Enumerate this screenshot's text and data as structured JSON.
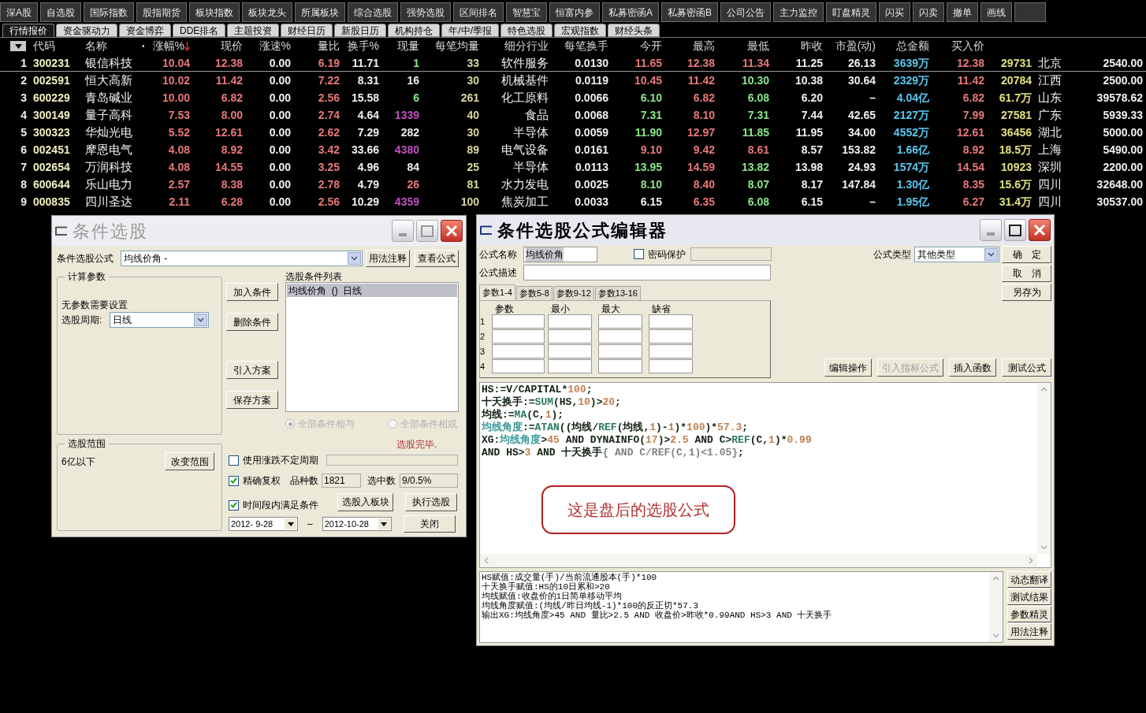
{
  "toolbar": [
    {
      "kind": "normal",
      "label": "深A股"
    },
    {
      "kind": "normal",
      "label": "自选股"
    },
    {
      "kind": "normal",
      "label": "国际指数"
    },
    {
      "kind": "normal",
      "label": "股指期货"
    },
    {
      "kind": "normal",
      "label": "板块指数"
    },
    {
      "kind": "normal",
      "label": "板块龙头"
    },
    {
      "kind": "normal",
      "label": "所属板块"
    },
    {
      "kind": "normal",
      "label": "综合选股"
    },
    {
      "kind": "normal",
      "label": "强势选股"
    },
    {
      "kind": "normal",
      "label": "区间排名"
    },
    {
      "kind": "normal",
      "label": "智慧宝"
    },
    {
      "kind": "normal",
      "label": "恒富内参"
    },
    {
      "kind": "normal",
      "label": "私募密函A"
    },
    {
      "kind": "normal",
      "label": "私募密函B"
    },
    {
      "kind": "normal",
      "label": "公司公告"
    },
    {
      "kind": "normal",
      "label": "主力监控"
    },
    {
      "kind": "normal",
      "label": "盯盘精灵"
    },
    {
      "kind": "normal",
      "label": "闪买"
    },
    {
      "kind": "normal",
      "label": "闪卖"
    },
    {
      "kind": "normal",
      "label": "撤单"
    },
    {
      "kind": "normal",
      "label": "画线"
    },
    {
      "kind": "alert"
    }
  ],
  "tabs": [
    {
      "label": "行情报价",
      "selected": true
    },
    {
      "label": "资金驱动力",
      "selected": false
    },
    {
      "label": "资金博弈",
      "selected": false
    },
    {
      "label": "DDE排名",
      "selected": false
    },
    {
      "label": "主题投资",
      "selected": false
    },
    {
      "label": "财经日历",
      "selected": false
    },
    {
      "label": "新股日历",
      "selected": false
    },
    {
      "label": "机构持仓",
      "selected": false
    },
    {
      "label": "年/中/季报",
      "selected": false
    },
    {
      "label": "特色选股",
      "selected": false
    },
    {
      "label": "宏观指数",
      "selected": false
    },
    {
      "label": "财经头条",
      "selected": false
    }
  ],
  "table": {
    "columns": [
      {
        "kind": "menu",
        "sorted": false
      },
      {
        "kind": "text",
        "label": "代码",
        "sorted": false
      },
      {
        "kind": "text",
        "label": "名称",
        "sorted": false
      },
      {
        "kind": "text",
        "prefix": "•",
        "label": "涨幅%",
        "sorted": true
      },
      {
        "label": "现价",
        "sorted": false
      },
      {
        "label": "涨速%",
        "sorted": false
      },
      {
        "label": "量比",
        "sorted": false
      },
      {
        "label": "换手%",
        "sorted": false
      },
      {
        "label": "现量",
        "sorted": false
      },
      {
        "label": "每笔均量",
        "sorted": false
      },
      {
        "label": "细分行业",
        "sorted": false
      },
      {
        "label": "每笔换手",
        "sorted": false
      },
      {
        "label": "今开",
        "sorted": false
      },
      {
        "label": "最高",
        "sorted": false
      },
      {
        "label": "最低",
        "sorted": false
      },
      {
        "label": "昨收",
        "sorted": false
      },
      {
        "label": "市盈(动)",
        "sorted": false
      },
      {
        "label": "总金额",
        "sorted": false
      },
      {
        "label": "买入价",
        "sorted": false
      }
    ],
    "rows": [
      {
        "selected": true,
        "cells": [
          {
            "text": "1"
          },
          {
            "text": "300231",
            "color": "#f0f0c0"
          },
          {
            "text": "银信科技"
          },
          {
            "text": "10.04",
            "color": "#e87878"
          },
          {
            "text": "12.38",
            "color": "#e87878"
          },
          {
            "text": "0.00"
          },
          {
            "text": "6.19",
            "color": "#e87878"
          },
          {
            "text": "11.71"
          },
          {
            "text": "1",
            "color": "#88e888"
          },
          {
            "text": "33",
            "color": "#d8d8a0"
          },
          {
            "text": "软件服务"
          },
          {
            "text": "0.0130"
          },
          {
            "text": "11.65",
            "color": "#e87878"
          },
          {
            "text": "12.38",
            "color": "#e87878"
          },
          {
            "text": "11.34",
            "color": "#e87878"
          },
          {
            "text": "11.25"
          },
          {
            "text": "26.13"
          },
          {
            "text": "3639万",
            "color": "#58c8f0"
          },
          {
            "text": "12.38",
            "color": "#e87878"
          },
          {
            "text": "29731",
            "color": "#e0e080"
          },
          {
            "text": "北京"
          },
          {
            "text": "2540.00"
          }
        ]
      },
      {
        "selected": false,
        "cells": [
          {
            "text": "2"
          },
          {
            "text": "002591",
            "color": "#f0f0c0"
          },
          {
            "text": "恒大高新"
          },
          {
            "text": "10.02",
            "color": "#e87878"
          },
          {
            "text": "11.42",
            "color": "#e87878"
          },
          {
            "text": "0.00"
          },
          {
            "text": "7.22",
            "color": "#e87878"
          },
          {
            "text": "8.31"
          },
          {
            "text": "16"
          },
          {
            "text": "30",
            "color": "#d8d8a0"
          },
          {
            "text": "机械基件"
          },
          {
            "text": "0.0119"
          },
          {
            "text": "10.45",
            "color": "#e87878"
          },
          {
            "text": "11.42",
            "color": "#e87878"
          },
          {
            "text": "10.30",
            "color": "#88e888"
          },
          {
            "text": "10.38"
          },
          {
            "text": "30.64"
          },
          {
            "text": "2329万",
            "color": "#58c8f0"
          },
          {
            "text": "11.42",
            "color": "#e87878"
          },
          {
            "text": "20784",
            "color": "#e0e080"
          },
          {
            "text": "江西"
          },
          {
            "text": "2500.00"
          }
        ]
      },
      {
        "selected": false,
        "cells": [
          {
            "text": "3"
          },
          {
            "text": "600229",
            "color": "#f0f0c0"
          },
          {
            "text": "青岛碱业"
          },
          {
            "text": "10.00",
            "color": "#e87878"
          },
          {
            "text": "6.82",
            "color": "#e87878"
          },
          {
            "text": "0.00"
          },
          {
            "text": "2.56",
            "color": "#e87878"
          },
          {
            "text": "15.58"
          },
          {
            "text": "6",
            "color": "#88e888"
          },
          {
            "text": "261",
            "color": "#d8d8a0"
          },
          {
            "text": "化工原料"
          },
          {
            "text": "0.0066"
          },
          {
            "text": "6.10",
            "color": "#88e888"
          },
          {
            "text": "6.82",
            "color": "#e87878"
          },
          {
            "text": "6.08",
            "color": "#88e888"
          },
          {
            "text": "6.20"
          },
          {
            "text": "–"
          },
          {
            "text": "4.04亿",
            "color": "#58c8f0"
          },
          {
            "text": "6.82",
            "color": "#e87878"
          },
          {
            "text": "61.7万",
            "color": "#e0e080"
          },
          {
            "text": "山东"
          },
          {
            "text": "39578.62"
          }
        ]
      },
      {
        "selected": false,
        "cells": [
          {
            "text": "4"
          },
          {
            "text": "300149",
            "color": "#f0f0c0"
          },
          {
            "text": "量子高科"
          },
          {
            "text": "7.53",
            "color": "#e87878"
          },
          {
            "text": "8.00",
            "color": "#e87878"
          },
          {
            "text": "0.00"
          },
          {
            "text": "2.74",
            "color": "#e87878"
          },
          {
            "text": "4.64"
          },
          {
            "text": "1339",
            "color": "#c050c0"
          },
          {
            "text": "40",
            "color": "#d8d8a0"
          },
          {
            "text": "食品"
          },
          {
            "text": "0.0068"
          },
          {
            "text": "7.31",
            "color": "#88e888"
          },
          {
            "text": "8.10",
            "color": "#e87878"
          },
          {
            "text": "7.31",
            "color": "#88e888"
          },
          {
            "text": "7.44"
          },
          {
            "text": "42.65"
          },
          {
            "text": "2127万",
            "color": "#58c8f0"
          },
          {
            "text": "7.99",
            "color": "#e87878"
          },
          {
            "text": "27581",
            "color": "#e0e080"
          },
          {
            "text": "广东"
          },
          {
            "text": "5939.33"
          }
        ]
      },
      {
        "selected": false,
        "cells": [
          {
            "text": "5"
          },
          {
            "text": "300323",
            "color": "#f0f0c0"
          },
          {
            "text": "华灿光电"
          },
          {
            "text": "5.52",
            "color": "#e87878"
          },
          {
            "text": "12.61",
            "color": "#e87878"
          },
          {
            "text": "0.00"
          },
          {
            "text": "2.62",
            "color": "#e87878"
          },
          {
            "text": "7.29"
          },
          {
            "text": "282"
          },
          {
            "text": "30",
            "color": "#d8d8a0"
          },
          {
            "text": "半导体"
          },
          {
            "text": "0.0059"
          },
          {
            "text": "11.90",
            "color": "#88e888"
          },
          {
            "text": "12.97",
            "color": "#e87878"
          },
          {
            "text": "11.85",
            "color": "#88e888"
          },
          {
            "text": "11.95"
          },
          {
            "text": "34.00"
          },
          {
            "text": "4552万",
            "color": "#58c8f0"
          },
          {
            "text": "12.61",
            "color": "#e87878"
          },
          {
            "text": "36456",
            "color": "#e0e080"
          },
          {
            "text": "湖北"
          },
          {
            "text": "5000.00"
          }
        ]
      },
      {
        "selected": false,
        "cells": [
          {
            "text": "6"
          },
          {
            "text": "002451",
            "color": "#f0f0c0"
          },
          {
            "text": "摩恩电气"
          },
          {
            "text": "4.08",
            "color": "#e87878"
          },
          {
            "text": "8.92",
            "color": "#e87878"
          },
          {
            "text": "0.00"
          },
          {
            "text": "3.42",
            "color": "#e87878"
          },
          {
            "text": "33.66"
          },
          {
            "text": "4380",
            "color": "#c050c0"
          },
          {
            "text": "89",
            "color": "#d8d8a0"
          },
          {
            "text": "电气设备"
          },
          {
            "text": "0.0161"
          },
          {
            "text": "9.10",
            "color": "#e87878"
          },
          {
            "text": "9.42",
            "color": "#e87878"
          },
          {
            "text": "8.61",
            "color": "#e87878"
          },
          {
            "text": "8.57"
          },
          {
            "text": "153.82"
          },
          {
            "text": "1.66亿",
            "color": "#58c8f0"
          },
          {
            "text": "8.92",
            "color": "#e87878"
          },
          {
            "text": "18.5万",
            "color": "#e0e080"
          },
          {
            "text": "上海"
          },
          {
            "text": "5490.00"
          }
        ]
      },
      {
        "selected": false,
        "cells": [
          {
            "text": "7"
          },
          {
            "text": "002654",
            "color": "#f0f0c0"
          },
          {
            "text": "万润科技"
          },
          {
            "text": "4.08",
            "color": "#e87878"
          },
          {
            "text": "14.55",
            "color": "#e87878"
          },
          {
            "text": "0.00"
          },
          {
            "text": "3.25",
            "color": "#e87878"
          },
          {
            "text": "4.96"
          },
          {
            "text": "84"
          },
          {
            "text": "25",
            "color": "#d8d8a0"
          },
          {
            "text": "半导体"
          },
          {
            "text": "0.0113"
          },
          {
            "text": "13.95",
            "color": "#88e888"
          },
          {
            "text": "14.59",
            "color": "#e87878"
          },
          {
            "text": "13.82",
            "color": "#88e888"
          },
          {
            "text": "13.98"
          },
          {
            "text": "24.93"
          },
          {
            "text": "1574万",
            "color": "#58c8f0"
          },
          {
            "text": "14.54",
            "color": "#e87878"
          },
          {
            "text": "10923",
            "color": "#e0e080"
          },
          {
            "text": "深圳"
          },
          {
            "text": "2200.00"
          }
        ]
      },
      {
        "selected": false,
        "cells": [
          {
            "text": "8"
          },
          {
            "text": "600644",
            "color": "#f0f0c0"
          },
          {
            "text": "乐山电力"
          },
          {
            "text": "2.57",
            "color": "#e87878"
          },
          {
            "text": "8.38",
            "color": "#e87878"
          },
          {
            "text": "0.00"
          },
          {
            "text": "2.78",
            "color": "#e87878"
          },
          {
            "text": "4.79"
          },
          {
            "text": "26",
            "color": "#e87878"
          },
          {
            "text": "81",
            "color": "#d8d8a0"
          },
          {
            "text": "水力发电"
          },
          {
            "text": "0.0025"
          },
          {
            "text": "8.10",
            "color": "#88e888"
          },
          {
            "text": "8.40",
            "color": "#e87878"
          },
          {
            "text": "8.07",
            "color": "#88e888"
          },
          {
            "text": "8.17"
          },
          {
            "text": "147.84"
          },
          {
            "text": "1.30亿",
            "color": "#58c8f0"
          },
          {
            "text": "8.35",
            "color": "#e87878"
          },
          {
            "text": "15.6万",
            "color": "#e0e080"
          },
          {
            "text": "四川"
          },
          {
            "text": "32648.00"
          }
        ]
      },
      {
        "selected": false,
        "cells": [
          {
            "text": "9"
          },
          {
            "text": "000835",
            "color": "#f0f0c0"
          },
          {
            "text": "四川圣达"
          },
          {
            "text": "2.11",
            "color": "#e87878"
          },
          {
            "text": "6.28",
            "color": "#e87878"
          },
          {
            "text": "0.00"
          },
          {
            "text": "2.56",
            "color": "#e87878"
          },
          {
            "text": "10.29"
          },
          {
            "text": "4359",
            "color": "#c050c0"
          },
          {
            "text": "100",
            "color": "#d8d8a0"
          },
          {
            "text": "焦炭加工"
          },
          {
            "text": "0.0033"
          },
          {
            "text": "6.15"
          },
          {
            "text": "6.35",
            "color": "#e87878"
          },
          {
            "text": "6.08",
            "color": "#88e888"
          },
          {
            "text": "6.15"
          },
          {
            "text": "–"
          },
          {
            "text": "1.95亿",
            "color": "#58c8f0"
          },
          {
            "text": "6.27",
            "color": "#e87878"
          },
          {
            "text": "31.4万",
            "color": "#e0e080"
          },
          {
            "text": "四川"
          },
          {
            "text": "30537.00"
          }
        ]
      }
    ]
  },
  "screener_dialog": {
    "title": "条件选股",
    "active": false,
    "formula_label": "条件选股公式",
    "formula_value": "均线价角 -",
    "usage_button": "用法注释",
    "view_button": "查看公式",
    "params_group": "计算参数",
    "params_note": "无参数需要设置",
    "period_label": "选股周期:",
    "period_value": "日线",
    "range_group": "选股范围",
    "range_value": "6亿以下",
    "range_button": "改变范围",
    "action_buttons": [
      "加入条件",
      "删除条件",
      "引入方案",
      "保存方案"
    ],
    "list_label": "选股条件列表",
    "conditions": [
      {
        "text": "均线价角  ()  日线",
        "selected": true
      }
    ],
    "radios": [
      {
        "label": "全部条件相与",
        "selected": true,
        "disabled": true
      },
      {
        "label": "全部条件相或",
        "selected": false,
        "disabled": true
      }
    ],
    "status": "选股完毕.",
    "options": [
      {
        "label": "使用涨跌不定周期",
        "checked": false
      },
      {
        "label": "精确复权",
        "checked": true
      },
      {
        "label": "时间段内满足条件",
        "checked": true
      }
    ],
    "progress": {
      "level": 0
    },
    "count_label": "品种数",
    "count_value": "1821",
    "selected_label": "选中数",
    "selected_value": "9/0.5%",
    "to_block_button": "选股入板块",
    "run_button": "执行选股",
    "close_button": "关闭",
    "date_from": "2012- 9-28",
    "date_sep": "–",
    "date_to": "2012-10-28"
  },
  "editor_dialog": {
    "title": "条件选股公式编辑器",
    "active": true,
    "name_label": "公式名称",
    "name_value": "均线价角",
    "password": {
      "label": "密码保护",
      "checked": false
    },
    "type_label": "公式类型",
    "type_value": "其他类型",
    "desc_label": "公式描述",
    "side_buttons": [
      "确　定",
      "取　消",
      "另存为"
    ],
    "param_tabs": [
      {
        "label": "参数1-4",
        "selected": true
      },
      {
        "label": "参数5-8",
        "selected": false
      },
      {
        "label": "参数9-12",
        "selected": false
      },
      {
        "label": "参数13-16",
        "selected": false
      }
    ],
    "param_headers": [
      "参数",
      "最小",
      "最大",
      "缺省"
    ],
    "param_rows": [
      "1",
      "2",
      "3",
      "4"
    ],
    "tool_buttons": [
      {
        "label": "编辑操作",
        "disabled": false
      },
      {
        "label": "引入指标公式",
        "disabled": true
      },
      {
        "label": "插入函数",
        "disabled": false
      },
      {
        "label": "测试公式",
        "disabled": false
      }
    ],
    "code": [
      [
        {
          "text": "HS:=V/CAPITAL*",
          "color": "#102010"
        },
        {
          "text": "100",
          "color": "#c08050"
        },
        {
          "text": ";",
          "color": "#102010"
        }
      ],
      [
        {
          "text": "十天换手:=",
          "color": "#102010"
        },
        {
          "text": "SUM",
          "color": "#2a7a60"
        },
        {
          "text": "(HS,",
          "color": "#102010"
        },
        {
          "text": "10",
          "color": "#c08050"
        },
        {
          "text": ")>",
          "color": "#102010"
        },
        {
          "text": "20",
          "color": "#c08050"
        },
        {
          "text": ";",
          "color": "#102010"
        }
      ],
      [
        {
          "text": "均线:=",
          "color": "#102010"
        },
        {
          "text": "MA",
          "color": "#2a7a60"
        },
        {
          "text": "(C,",
          "color": "#102010"
        },
        {
          "text": "1",
          "color": "#c08050"
        },
        {
          "text": ");",
          "color": "#102010"
        }
      ],
      [
        {
          "text": "均线角度",
          "color": "#3a9a9a"
        },
        {
          "text": ":=",
          "color": "#102010"
        },
        {
          "text": "ATAN",
          "color": "#2a7a60"
        },
        {
          "text": "((均线/",
          "color": "#102010"
        },
        {
          "text": "REF",
          "color": "#2a7a60"
        },
        {
          "text": "(均线,",
          "color": "#102010"
        },
        {
          "text": "1",
          "color": "#c08050"
        },
        {
          "text": ")-",
          "color": "#102010"
        },
        {
          "text": "1",
          "color": "#c08050"
        },
        {
          "text": ")*",
          "color": "#102010"
        },
        {
          "text": "100",
          "color": "#c08050"
        },
        {
          "text": ")*",
          "color": "#102010"
        },
        {
          "text": "57.3",
          "color": "#c08050"
        },
        {
          "text": ";",
          "color": "#102010"
        }
      ],
      [
        {
          "text": "XG:",
          "color": "#102010"
        },
        {
          "text": "均线角度",
          "color": "#3a9a9a"
        },
        {
          "text": ">",
          "color": "#102010"
        },
        {
          "text": "45",
          "color": "#c08050"
        },
        {
          "text": " AND DYNAINFO(",
          "color": "#102010"
        },
        {
          "text": "17",
          "color": "#c08050"
        },
        {
          "text": ")>",
          "color": "#102010"
        },
        {
          "text": "2.5",
          "color": "#c08050"
        },
        {
          "text": " AND C>",
          "color": "#102010"
        },
        {
          "text": "REF",
          "color": "#2a7a60"
        },
        {
          "text": "(C,",
          "color": "#102010"
        },
        {
          "text": "1",
          "color": "#c08050"
        },
        {
          "text": ")*",
          "color": "#102010"
        },
        {
          "text": "0.99",
          "color": "#c08050"
        }
      ],
      [
        {
          "text": "AND HS>",
          "color": "#102010"
        },
        {
          "text": "3",
          "color": "#c08050"
        },
        {
          "text": " AND 十天换手",
          "color": "#102010"
        },
        {
          "text": "{ AND C/REF(C,1)<1.05}",
          "color": "#808080"
        },
        {
          "text": ";",
          "color": "#102010"
        }
      ]
    ],
    "callout": "这是盘后的选股公式",
    "description": [
      "HS赋值:成交量(手)/当前流通股本(手)*100",
      "十天换手赋值:HS的10日累和>20",
      "均线赋值:收盘价的1日简单移动平均",
      "均线角度赋值:(均线/昨日均线-1)*100的反正切*57.3",
      "输出XG:均线角度>45 AND 量比>2.5 AND 收盘价>昨收*0.99AND HS>3 AND 十天换手"
    ],
    "desc_buttons": [
      "动态翻译",
      "测试结果",
      "参数精灵",
      "用法注释"
    ]
  }
}
